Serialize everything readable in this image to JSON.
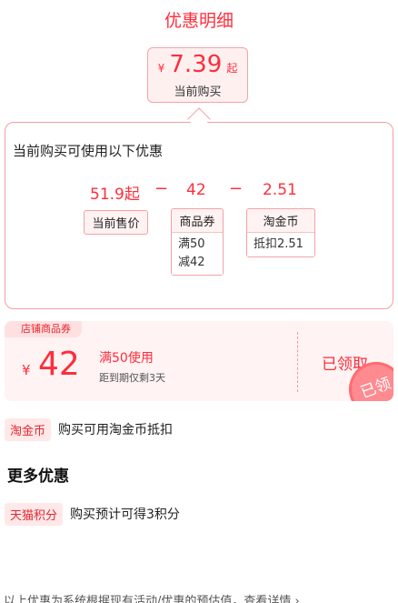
{
  "header": {
    "title": "优惠明细"
  },
  "price": {
    "currency": "¥",
    "value": "7.39",
    "suffix": "起",
    "caption": "当前购买"
  },
  "breakdown": {
    "title": "当前购买可使用以下优惠",
    "values": [
      "51.9起",
      "42",
      "2.51"
    ],
    "operators": [
      "−",
      "−"
    ],
    "items": [
      {
        "label": "当前售价"
      },
      {
        "label": "商品券",
        "details": [
          "满50",
          "减42"
        ]
      },
      {
        "label": "淘金币",
        "details": [
          "抵扣2.51"
        ]
      }
    ]
  },
  "coupon": {
    "tag": "店铺商品券",
    "currency": "¥",
    "amount": "42",
    "condition": "满50使用",
    "expiry": "距到期仅剩3天",
    "status": "已领取",
    "stamp": "已领"
  },
  "taojinbi_row": {
    "tag": "淘金币",
    "text": "购买可用淘金币抵扣"
  },
  "more": {
    "title": "更多优惠"
  },
  "tmall_row": {
    "tag": "天猫积分",
    "text": "购买预计可得3积分"
  },
  "footer": {
    "text": "以上优惠为系统根据现有活动/优惠的预估值，查看详情 ›"
  }
}
